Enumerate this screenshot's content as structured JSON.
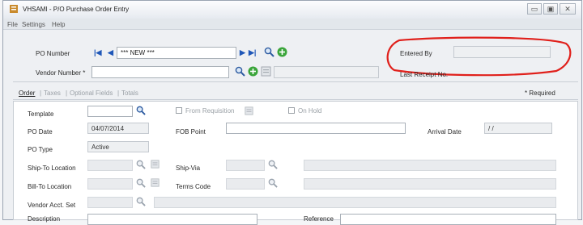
{
  "window": {
    "title": "VHSAMI - P/O Purchase Order Entry",
    "controls": {
      "minimize": "▭",
      "restore": "▣",
      "close": "✕"
    }
  },
  "menu": [
    "File",
    "Settings",
    "Help"
  ],
  "header": {
    "po_number_label": "PO Number",
    "po_number_value": "*** NEW ***",
    "vendor_number_label": "Vendor Number *",
    "vendor_number_value": "",
    "entered_by_label": "Entered By",
    "entered_by_value": "",
    "last_receipt_label": "Last Receipt No.",
    "last_receipt_value": "",
    "highlight_color": "#e0201b"
  },
  "tabs": [
    "Order",
    "Taxes",
    "Optional Fields",
    "Totals"
  ],
  "required_note": "* Required",
  "form": {
    "template_label": "Template",
    "template_value": "",
    "from_requisition_label": "From Requisition",
    "on_hold_label": "On Hold",
    "po_date_label": "PO Date",
    "po_date_value": "04/07/2014",
    "fob_point_label": "FOB Point",
    "fob_point_value": "",
    "arrival_date_label": "Arrival Date",
    "arrival_date_value": "/ /",
    "po_type_label": "PO Type",
    "po_type_value": "Active",
    "ship_to_label": "Ship-To Location",
    "ship_via_label": "Ship-Via",
    "bill_to_label": "Bill-To Location",
    "terms_code_label": "Terms Code",
    "vendor_acct_label": "Vendor Acct. Set",
    "description_label": "Description",
    "reference_label": "Reference"
  }
}
